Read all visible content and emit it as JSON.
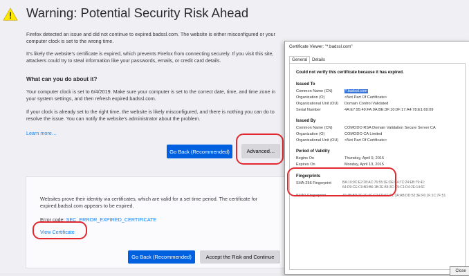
{
  "page": {
    "title": "Warning: Potential Security Risk Ahead",
    "intro": "Firefox detected an issue and did not continue to expired.badssl.com. The website is either misconfigured or your computer clock is set to the wrong time.",
    "explain": "It’s likely the website’s certificate is expired, which prevents Firefox from connecting securely. If you visit this site, attackers could try to steal information like your passwords, emails, or credit card details.",
    "heading": "What can you do about it?",
    "clock_text": "Your computer clock is set to 6/4/2019. Make sure your computer is set to the correct date, time, and time zone in your system settings, and then refresh expired.badssl.com.",
    "if_right_text": "If your clock is already set to the right time, the website is likely misconfigured, and there is nothing you can do to resolve the issue. You can notify the website’s administrator about the problem.",
    "learn_more": "Learn more…",
    "go_back_label": "Go Back (Recommended)",
    "advanced_label": "Advanced…"
  },
  "advanced_panel": {
    "text": "Websites prove their identity via certificates, which are valid for a set time period. The certificate for expired.badssl.com appears to be expired.",
    "error_prefix": "Error code: ",
    "error_code": "SEC_ERROR_EXPIRED_CERTIFICATE",
    "view_certificate": "View Certificate",
    "go_back_label": "Go Back (Recommended)",
    "accept_label": "Accept the Risk and Continue"
  },
  "cert_viewer": {
    "title": "Certificate Viewer: \"*.badssl.com\"",
    "tabs": [
      "General",
      "Details"
    ],
    "error_text": "Could not verify this certificate because it has expired.",
    "issued_to_heading": "Issued To",
    "issued_to": [
      {
        "label": "Common Name (CN)",
        "value": "*.badssl.com"
      },
      {
        "label": "Organization (O)",
        "value": "<Not Part Of Certificate>"
      },
      {
        "label": "Organizational Unit (OU)",
        "value": "Domain Control Validated"
      },
      {
        "label": "Serial Number",
        "value": "4A:E7:95:49:FA:9A:BE:3F:10:0F:17:A4:78:E1:69:09"
      }
    ],
    "issued_by_heading": "Issued By",
    "issued_by": [
      {
        "label": "Common Name (CN)",
        "value": "COMODO RSA Domain Validation Secure Server CA"
      },
      {
        "label": "Organization (O)",
        "value": "COMODO CA Limited"
      },
      {
        "label": "Organizational Unit (OU)",
        "value": "<Not Part Of Certificate>"
      }
    ],
    "validity_heading": "Period of Validity",
    "validity": [
      {
        "label": "Begins On",
        "value": "Thursday, April 9, 2015"
      },
      {
        "label": "Expires On",
        "value": "Monday, April 13, 2015"
      }
    ],
    "fingerprints_heading": "Fingerprints",
    "fingerprints": [
      {
        "label": "SHA-256 Fingerprint",
        "value_line1": "BA:10:9C:E2:28:AC:76:55:3E:DE:E4:7C:24:EB:79:41:",
        "value_line2": "64:D9:CE:C9:B3:B6:1B:2E:83:3C:C5:C1:D4:2E:14:6F"
      },
      {
        "label": "SHA1 Fingerprint",
        "value_line1": "40:4B:BD:2F:1F:4C:C2:FD:6E:F1:3A:AB:DD:52:3E:F6:1F:1C:7F:51",
        "value_line2": ""
      }
    ],
    "close_label": "Close"
  },
  "colors": {
    "accent_blue": "#0060df",
    "link_blue": "#0a84ff",
    "annotation_red": "#e0282e",
    "warning_yellow": "#ffe900"
  }
}
